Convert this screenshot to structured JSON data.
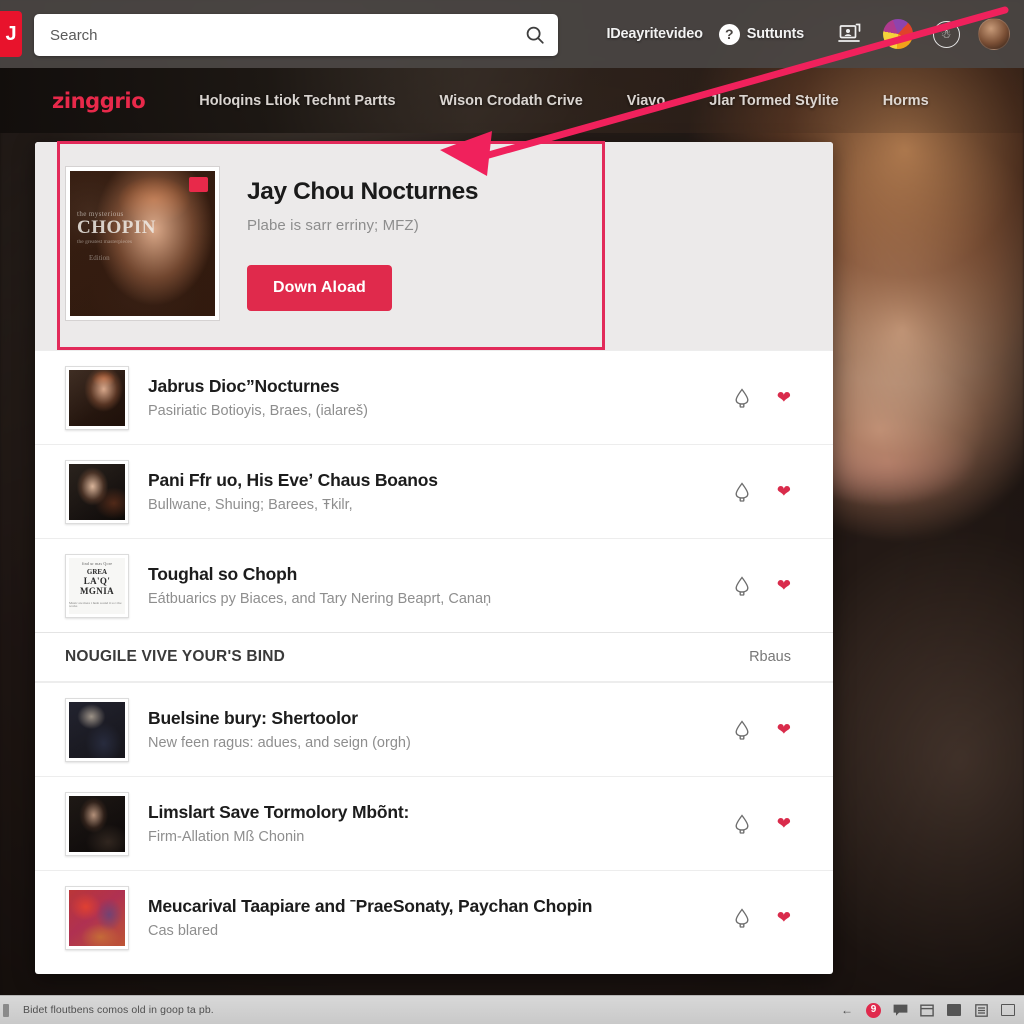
{
  "topbar": {
    "logo_glyph": "J",
    "search_placeholder": "Search",
    "search_value": "",
    "search_icon": "search-icon",
    "video_label": "IDeayritevideo",
    "help_glyph": "?",
    "students_label": "Suttunts",
    "screen_icon": "screen-share-icon",
    "pie_icon": "pie-chart-icon",
    "ring_icon": "accessibility-icon",
    "avatar_icon": "user-avatar"
  },
  "sitenav": {
    "brand": "zinggrio",
    "links": [
      {
        "label": "Holoqins Ltiok Technt Partts"
      },
      {
        "label": "Wison Crodath Crive"
      },
      {
        "label": "Viavo"
      },
      {
        "label": "Jlar Tormed Stylite"
      },
      {
        "label": "Horms"
      }
    ]
  },
  "hero": {
    "cover": {
      "badge": "hd-badge",
      "line_small": "the mysterious",
      "line_big": "CHOPIN",
      "line_tiny": "the greatest masterpieces",
      "line_sub": "Edition"
    },
    "title": "Jay Chou Nocturnes",
    "subtitle": "Plabe is sarr erriny; MFZ)",
    "download_label": "Down Aload"
  },
  "list": [
    {
      "thumb": "thumb-a",
      "title": "Jabrus Dioc”Nocturnes",
      "subtitle": "Pasiriatic Botioyis, Braes, (ialareš)",
      "download_icon": "download-icon",
      "favorite_icon": "heart-icon"
    },
    {
      "thumb": "thumb-b",
      "title": "Pani Ffr uo, His Eveʼ Chaus Boanos",
      "subtitle": "Bullwane, Shuing; Barees, Ŧkilr,",
      "download_icon": "download-icon",
      "favorite_icon": "heart-icon"
    },
    {
      "thumb": "thumb-c",
      "title": "Toughal so Choph",
      "subtitle": "Eátbuariсs py Biaces, and Tary Nering Beaprt, Canaņ",
      "download_icon": "download-icon",
      "favorite_icon": "heart-icon"
    }
  ],
  "section": {
    "title": "NOUGILE VIVE YOUR'S BIND",
    "link": "Rbaus"
  },
  "list2": [
    {
      "thumb": "thumb-d",
      "title": "Buelsine bury: Shertoolor",
      "subtitle": "New feen ragus: adues, and seign (orgh)",
      "download_icon": "download-icon",
      "favorite_icon": "heart-icon"
    },
    {
      "thumb": "thumb-e",
      "title": "Limslart Save Tormolory Mbõnt:",
      "subtitle": "Firm-Allation Mß Chonin",
      "download_icon": "download-icon",
      "favorite_icon": "heart-icon"
    },
    {
      "thumb": "thumb-f",
      "title": "Meucarival Taapiare and ˉPraeSonaty, Paychan Chopin",
      "subtitle": "Cas blared",
      "download_icon": "download-icon",
      "favorite_icon": "heart-icon"
    }
  ],
  "statusbar": {
    "text": "Bidet floutbens comos old in goop ta pb.",
    "icons": [
      "back-arrow-icon",
      "notification-badge",
      "comment-icon",
      "archive-icon",
      "window-icon",
      "list-icon",
      "panel-icon"
    ],
    "badge_glyph": "9"
  },
  "colors": {
    "accent": "#e02a4c",
    "highlight": "#e22a5a",
    "brand": "#e8294a",
    "panel_bg": "#ffffff",
    "hero_bg": "#eceaea"
  }
}
